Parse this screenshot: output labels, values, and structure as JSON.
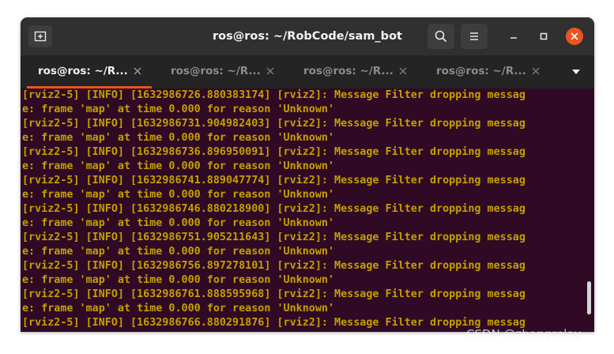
{
  "window": {
    "title": "ros@ros: ~/RobCode/sam_bot"
  },
  "titlebar": {
    "new_tab_icon": "new-tab-icon",
    "search_icon": "search-icon",
    "menu_icon": "hamburger-menu-icon",
    "minimize_icon": "minimize-icon",
    "maximize_icon": "maximize-icon",
    "close_icon": "close-icon"
  },
  "tabs": [
    {
      "label": "ros@ros: ~/R...",
      "active": true
    },
    {
      "label": "ros@ros: ~/R...",
      "active": false
    },
    {
      "label": "ros@ros: ~/R...",
      "active": false
    },
    {
      "label": "ros@ros: ~/R...",
      "active": false
    }
  ],
  "colors": {
    "terminal_bg": "#300a24",
    "log_text": "#c4a000",
    "accent": "#e95420"
  },
  "terminal": {
    "lines": [
      "[rviz2-5] [INFO] [1632986726.880383174] [rviz2]: Message Filter dropping messag",
      "e: frame 'map' at time 0.000 for reason 'Unknown'",
      "[rviz2-5] [INFO] [1632986731.904982403] [rviz2]: Message Filter dropping messag",
      "e: frame 'map' at time 0.000 for reason 'Unknown'",
      "[rviz2-5] [INFO] [1632986736.896950091] [rviz2]: Message Filter dropping messag",
      "e: frame 'map' at time 0.000 for reason 'Unknown'",
      "[rviz2-5] [INFO] [1632986741.889047774] [rviz2]: Message Filter dropping messag",
      "e: frame 'map' at time 0.000 for reason 'Unknown'",
      "[rviz2-5] [INFO] [1632986746.880218900] [rviz2]: Message Filter dropping messag",
      "e: frame 'map' at time 0.000 for reason 'Unknown'",
      "[rviz2-5] [INFO] [1632986751.905211643] [rviz2]: Message Filter dropping messag",
      "e: frame 'map' at time 0.000 for reason 'Unknown'",
      "[rviz2-5] [INFO] [1632986756.897278101] [rviz2]: Message Filter dropping messag",
      "e: frame 'map' at time 0.000 for reason 'Unknown'",
      "[rviz2-5] [INFO] [1632986761.888595968] [rviz2]: Message Filter dropping messag",
      "e: frame 'map' at time 0.000 for reason 'Unknown'",
      "[rviz2-5] [INFO] [1632986766.880291876] [rviz2]: Message Filter dropping messag"
    ],
    "scroll_position": 0.93
  },
  "watermark": {
    "text": "CSDN @zhangrelay"
  }
}
